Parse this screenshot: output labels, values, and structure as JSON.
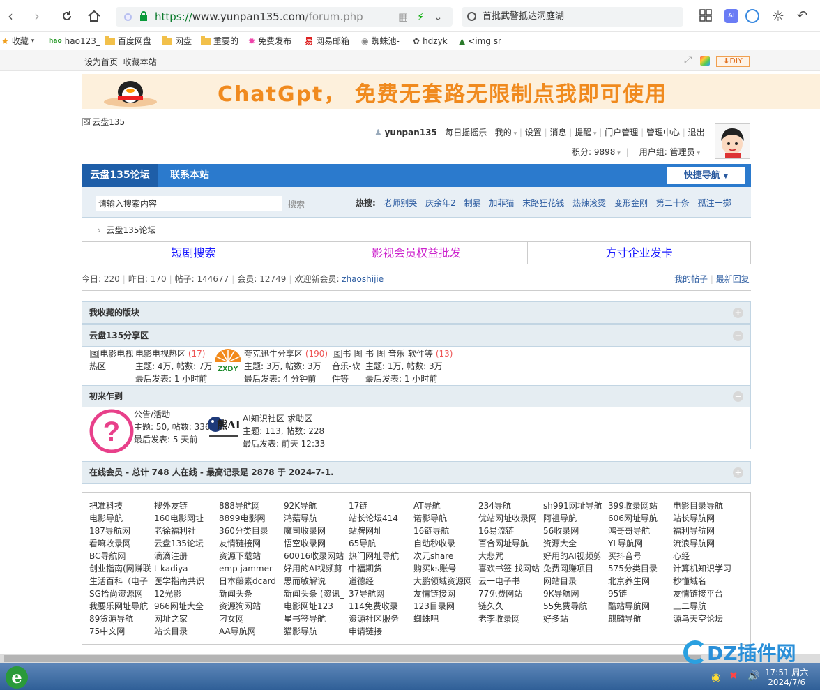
{
  "browser": {
    "url_prefix": "https://",
    "url_host": "www.yunpan135.com",
    "url_path": "/forum.php",
    "search_text": "首批武警抵达洞庭湖"
  },
  "bookmarks": [
    {
      "label": "收藏",
      "icon": "star-icon"
    },
    {
      "label": "hao123_",
      "icon": "hao123-icon"
    },
    {
      "label": "百度网盘",
      "icon": "folder-icon"
    },
    {
      "label": "网盘",
      "icon": "folder-icon"
    },
    {
      "label": "重要的",
      "icon": "folder-icon"
    },
    {
      "label": "免费发布",
      "icon": "pinwheel-icon"
    },
    {
      "label": "网易邮箱",
      "icon": "netease-icon"
    },
    {
      "label": "蜘蛛池-",
      "icon": "globe-icon"
    },
    {
      "label": "hdzyk",
      "icon": "site-icon"
    },
    {
      "label": "<img sr",
      "icon": "tree-icon"
    }
  ],
  "sitetop": {
    "set_home": "设为首页",
    "bookmark": "收藏本站",
    "diy": "DIY"
  },
  "banner": {
    "text": "ChatGpt， 免费无套路无限制点我即可使用"
  },
  "header": {
    "logo_alt": "云盘135",
    "username": "yunpan135",
    "links": [
      "每日摇摇乐",
      "我的",
      "设置",
      "消息",
      "提醒",
      "门户管理",
      "管理中心",
      "退出"
    ],
    "points": "积分: 9898",
    "usergroup": "用户组: 管理员"
  },
  "nav": {
    "tabs": [
      "云盘135论坛",
      "联系本站"
    ],
    "quicknav": "快捷导航"
  },
  "search": {
    "placeholder": "请输入搜索内容",
    "button": "搜索",
    "hot_label": "热搜:",
    "hot": [
      "老师别哭",
      "庆余年2",
      "制暴",
      "加菲猫",
      "末路狂花钱",
      "热辣滚烫",
      "变形金刚",
      "第二十条",
      "孤注一掷"
    ]
  },
  "breadcrumb": "云盘135论坛",
  "promo": [
    {
      "label": "短剧搜索",
      "color": "#1a1aff"
    },
    {
      "label": "影视会员权益批发",
      "color": "#cc22cc"
    },
    {
      "label": "方寸企业发卡",
      "color": "#1a1aff"
    }
  ],
  "stats": {
    "today": "今日: 220",
    "yesterday": "昨日: 170",
    "posts": "帖子: 144677",
    "members": "会员: 12749",
    "welcome": "欢迎新会员: ",
    "newest": "zhaoshijie",
    "my_posts": "我的帖子",
    "latest": "最新回复"
  },
  "groups": {
    "favorites": "我收藏的版块",
    "share": {
      "title": "云盘135分享区",
      "forums": [
        {
          "img_alt": "电影电视热区",
          "name": "电影电视热区",
          "count": "(17)",
          "stats": "主题: 4万, 帖数: 7万",
          "last": "最后发表: 1 小时前"
        },
        {
          "img_alt": "ZXDY",
          "name": "夸克迅牛分享区",
          "count": "(190)",
          "stats": "主题: 3万, 帖数: 3万",
          "last": "最后发表: 4 分钟前"
        },
        {
          "img_alt": "书-图-音乐-软件等",
          "name": "书-图-音乐-软件等",
          "count": "(13)",
          "stats": "主题: 1万, 帖数: 3万",
          "last": "最后发表: 1 小时前"
        }
      ]
    },
    "newbie": {
      "title": "初来乍到",
      "forums": [
        {
          "name": "公告/活动",
          "stats": "主题: 50, 帖数: 336",
          "last": "最后发表: 5 天前"
        },
        {
          "img_text": "熊AI",
          "name": "AI知识社区-求助区",
          "stats": "主题: 113, 帖数: 228",
          "last": "最后发表: 前天 12:33"
        }
      ]
    }
  },
  "online": "在线会员 - 总计 748 人在线 - 最高记录是 2878 于 2024-7-1.",
  "links": [
    [
      "把准科技",
      "搜外友链",
      "888导航网",
      "92K导航",
      "17链",
      "AT导航",
      "234导航",
      "sh991网址导航",
      "399收录网站",
      "电影目录导航"
    ],
    [
      "电影导航",
      "160电影网址",
      "8899电影网",
      "鸿菇导航",
      "站长论坛414",
      "诺影导航",
      "优站网址收录网",
      "阿祖导航",
      "606网址导航",
      "站长导航网"
    ],
    [
      "187导航网",
      "老徐福利社",
      "360分类目录",
      "魔司收录网",
      "站牌网址",
      "16链导航",
      "16易流链",
      "56收录网",
      "鸿哥哥导航",
      "福利导航网"
    ],
    [
      "看嘛收录网",
      "云盘135论坛",
      "友情链接网",
      "悟空收录网",
      "65导航",
      "自动秒收录",
      "百合网址导航",
      "资源大全",
      "YL导航网",
      "流浪导航网"
    ],
    [
      "BC导航网",
      "滴滴注册",
      "资源下载站",
      "60016收录网站",
      "热门网址导航",
      "次元share",
      "大悲咒",
      "好用的AI视频剪",
      "买抖音号",
      "心经"
    ],
    [
      "创业指南(网赚联",
      "t-kadiya",
      "emp jammer",
      "好用的AI视频剪",
      "中福期货",
      "购买ks账号",
      "喜欢书签 找网站",
      "免费网赚项目",
      "575分类目录",
      "计算机知识学习"
    ],
    [
      "生活百科（电子",
      "医学指南共识",
      "日本藤素dcard",
      "思而敏解说",
      "道德经",
      "大鹏领域资源网",
      "云一电子书",
      "网站目录",
      "北京养生网",
      "秒懂域名"
    ],
    [
      "SG拾尚资源网",
      "12光影",
      "新闻头条",
      "新闻头条 (资讯_",
      "37导航网",
      "友情链接网",
      "77免费网站",
      "9K导航网",
      "95链",
      "友情链接平台"
    ],
    [
      "我要乐网址导航",
      "966网址大全",
      "资源狗网站",
      "电影网址123",
      "114免费收录",
      "123目录网",
      "链久久",
      "55免费导航",
      "酷站导航网",
      "三二导航"
    ],
    [
      "89货源导航",
      "网址之家",
      "刁女网",
      "星书签导航",
      "资源社区服务",
      "蜘蛛吧",
      "老李收录网",
      "好多站",
      "麒麟导航",
      "源鸟天空论坛"
    ],
    [
      "75中文网",
      "站长目录",
      "AA导航网",
      "猫影导航",
      "申请链接"
    ]
  ],
  "taskbar": {
    "time": "17:51 周六",
    "date": "2024/7/6"
  },
  "watermark": "DZ插件网"
}
